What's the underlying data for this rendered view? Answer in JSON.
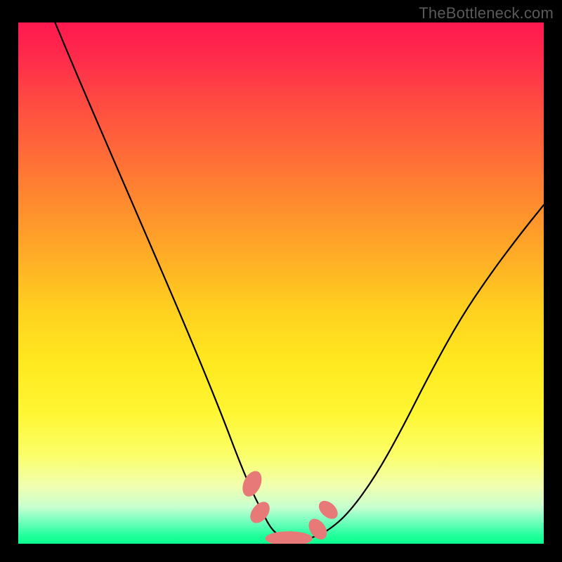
{
  "watermark": "TheBottleneck.com",
  "chart_data": {
    "type": "line",
    "title": "",
    "xlabel": "",
    "ylabel": "",
    "xlim": [
      0,
      100
    ],
    "ylim": [
      0,
      100
    ],
    "series": [
      {
        "name": "curve",
        "x": [
          7,
          12,
          18,
          24,
          30,
          35,
          39,
          42,
          44.5,
          46.5,
          48,
          50,
          52,
          54,
          56,
          59,
          63,
          68,
          73,
          78,
          84,
          90,
          96,
          100
        ],
        "y": [
          100,
          88,
          74,
          60,
          46,
          34,
          24,
          16,
          10,
          6,
          3,
          1.2,
          0.5,
          0.5,
          1.2,
          2.5,
          6,
          13,
          22,
          32,
          43,
          52,
          60,
          65
        ]
      }
    ],
    "markers": [
      {
        "name": "marker-1",
        "x": 44.5,
        "y": 11.5,
        "rx": 1.6,
        "ry": 2.6,
        "rot": 25
      },
      {
        "name": "marker-2",
        "x": 46.0,
        "y": 6.0,
        "rx": 1.5,
        "ry": 2.3,
        "rot": 38
      },
      {
        "name": "marker-3",
        "x": 51.5,
        "y": 1.0,
        "rx": 4.5,
        "ry": 1.4,
        "rot": 0
      },
      {
        "name": "marker-4",
        "x": 57.0,
        "y": 2.8,
        "rx": 1.45,
        "ry": 2.2,
        "rot": -35
      },
      {
        "name": "marker-5",
        "x": 59.0,
        "y": 6.5,
        "rx": 1.35,
        "ry": 2.1,
        "rot": -48
      }
    ],
    "gradient_stops": [
      {
        "pos": 0.0,
        "color": "#ff1850"
      },
      {
        "pos": 0.25,
        "color": "#ff6a38"
      },
      {
        "pos": 0.55,
        "color": "#ffd01f"
      },
      {
        "pos": 0.83,
        "color": "#fbff69"
      },
      {
        "pos": 0.97,
        "color": "#4dffae"
      },
      {
        "pos": 1.0,
        "color": "#0cff91"
      }
    ],
    "marker_color": "#e77a78",
    "curve_color": "#000000"
  }
}
